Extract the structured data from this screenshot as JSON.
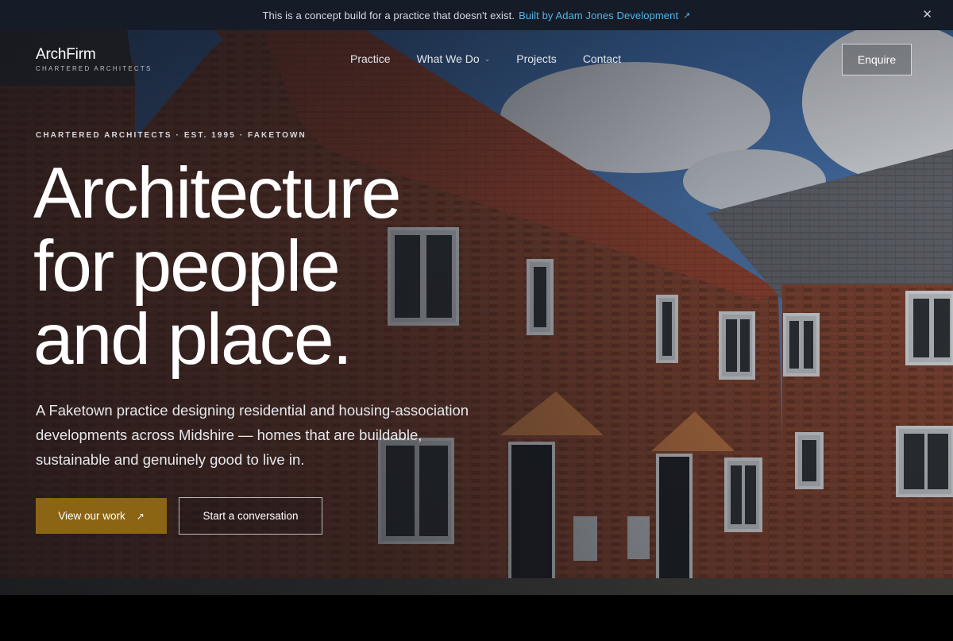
{
  "banner": {
    "message": "This is a concept build for a practice that doesn't exist.",
    "link_label": "Built by Adam Jones Development",
    "link_icon": "arrow-up-right-icon",
    "close_icon": "close-icon",
    "close_glyph": "✕"
  },
  "logo": {
    "name": "ArchFirm",
    "tagline": "CHARTERED ARCHITECTS"
  },
  "nav": {
    "items": [
      {
        "label": "Practice"
      },
      {
        "label": "What We Do",
        "has_dropdown": true
      },
      {
        "label": "Projects"
      },
      {
        "label": "Contact"
      }
    ],
    "cta_label": "Enquire"
  },
  "hero": {
    "eyebrow": "CHARTERED ARCHITECTS · EST. 1995 · FAKETOWN",
    "headline_lines": [
      "Architecture",
      "for people",
      "and place."
    ],
    "intro": "A Faketown practice designing residential and housing-association developments across Midshire — homes that are buildable, sustainable and genuinely good to live in.",
    "primary_button": "View our work",
    "secondary_button": "Start a conversation"
  },
  "colors": {
    "banner_bg": "#161b28",
    "banner_link": "#4fb6e8",
    "primary_button_bg": "#8b6514",
    "page_bg": "#000000"
  }
}
